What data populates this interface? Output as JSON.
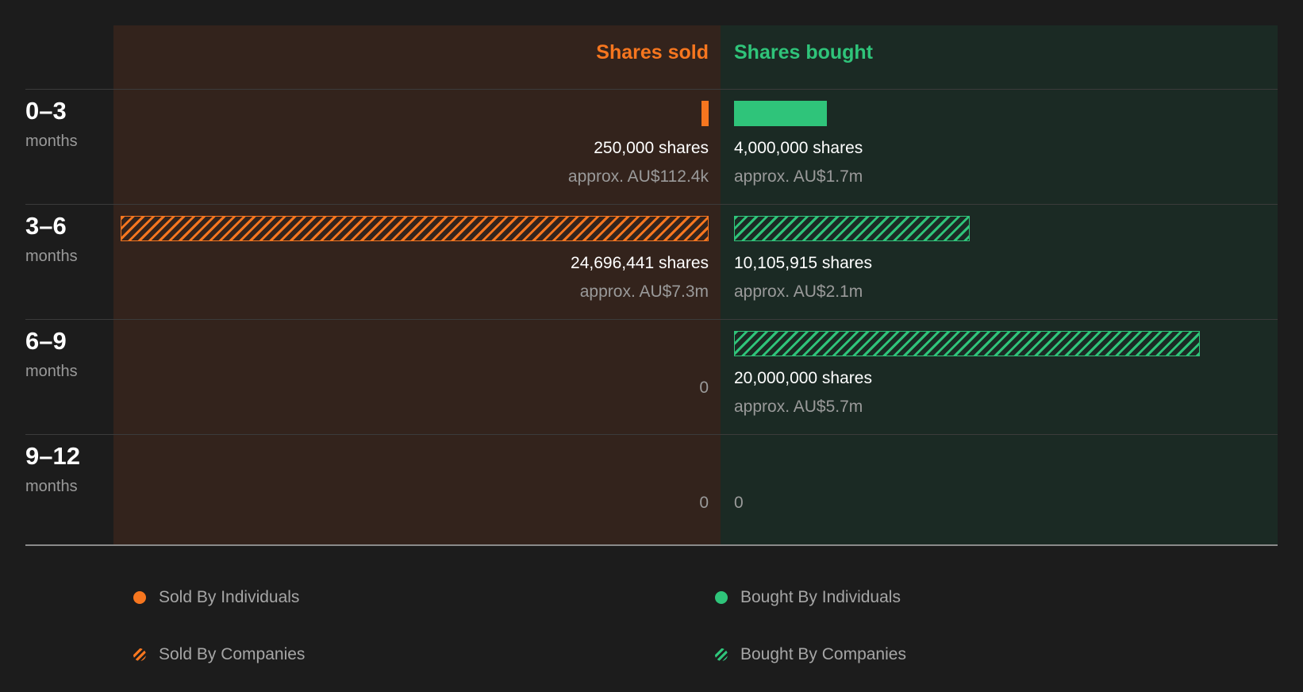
{
  "chart_data": {
    "type": "bar",
    "headers": {
      "sold": "Shares sold",
      "bought": "Shares bought"
    },
    "colors": {
      "sold": "#f6761f",
      "bought": "#2fc47a",
      "sold_panel": "#33231c",
      "bought_panel": "#1b2a24"
    },
    "rows": [
      {
        "range": "0–3",
        "unit": "months",
        "sold": {
          "shares": 250000,
          "shares_label": "250,000 shares",
          "approx": "approx. AU$112.4k",
          "style": "solid",
          "zero": ""
        },
        "bought": {
          "shares": 4000000,
          "shares_label": "4,000,000 shares",
          "approx": "approx. AU$1.7m",
          "style": "solid",
          "zero": ""
        }
      },
      {
        "range": "3–6",
        "unit": "months",
        "sold": {
          "shares": 24696441,
          "shares_label": "24,696,441 shares",
          "approx": "approx. AU$7.3m",
          "style": "hatched",
          "zero": ""
        },
        "bought": {
          "shares": 10105915,
          "shares_label": "10,105,915 shares",
          "approx": "approx. AU$2.1m",
          "style": "hatched",
          "zero": ""
        }
      },
      {
        "range": "6–9",
        "unit": "months",
        "sold": {
          "shares": 0,
          "shares_label": "",
          "approx": "",
          "style": "none",
          "zero": "0"
        },
        "bought": {
          "shares": 20000000,
          "shares_label": "20,000,000 shares",
          "approx": "approx. AU$5.7m",
          "style": "hatched",
          "zero": ""
        }
      },
      {
        "range": "9–12",
        "unit": "months",
        "sold": {
          "shares": 0,
          "shares_label": "",
          "approx": "",
          "style": "none",
          "zero": "0"
        },
        "bought": {
          "shares": 0,
          "shares_label": "",
          "approx": "",
          "style": "none",
          "zero": "0"
        }
      }
    ],
    "legend": [
      {
        "label": "Sold By Individuals",
        "marker": "solid-sold"
      },
      {
        "label": "Bought By Individuals",
        "marker": "solid-bought"
      },
      {
        "label": "Sold By Companies",
        "marker": "hatch-sold"
      },
      {
        "label": "Bought By Companies",
        "marker": "hatch-bought"
      }
    ]
  }
}
